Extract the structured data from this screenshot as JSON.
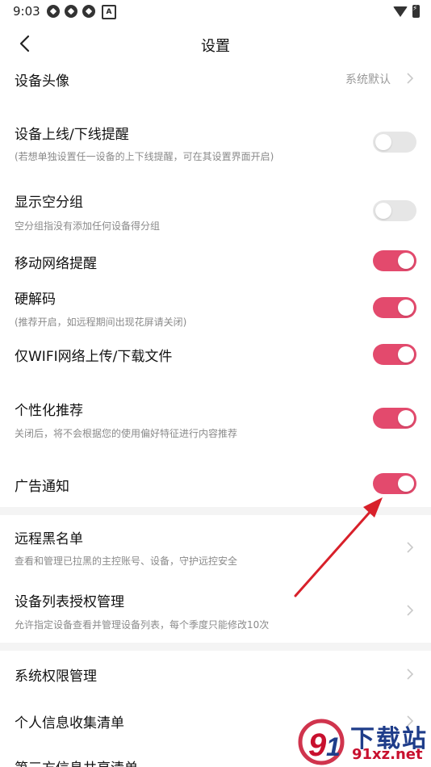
{
  "status_bar": {
    "time": "9:03",
    "left_icons": [
      "app-icon-1",
      "app-icon-2",
      "app-icon-3",
      "a-icon"
    ],
    "right_icons": [
      "wifi-icon",
      "battery-icon"
    ]
  },
  "header": {
    "title": "设置"
  },
  "rows": [
    {
      "label": "设备头像",
      "value": "系统默认"
    },
    {
      "label": "设备上线/下线提醒",
      "sub": "(若想单独设置任一设备的上下线提醒，可在其设置界面开启)",
      "on": false
    },
    {
      "label": "显示空分组",
      "sub": "空分组指没有添加任何设备得分组",
      "on": false
    },
    {
      "label": "移动网络提醒",
      "on": true
    },
    {
      "label": "硬解码",
      "sub": "(推荐开启，如远程期间出现花屏请关闭)",
      "on": true
    },
    {
      "label": "仅WIFI网络上传/下载文件",
      "on": true
    },
    {
      "label": "个性化推荐",
      "sub": "关闭后，将不会根据您的使用偏好特征进行内容推荐",
      "on": true
    },
    {
      "label": "广告通知",
      "on": true
    },
    {
      "label": "远程黑名单",
      "sub": "查看和管理已拉黑的主控账号、设备，守护远控安全"
    },
    {
      "label": "设备列表授权管理",
      "sub": "允许指定设备查看并管理设备列表，每个季度只能修改10次"
    },
    {
      "label": "系统权限管理"
    },
    {
      "label": "个人信息收集清单"
    },
    {
      "label": "第三方信息共享清单"
    }
  ],
  "colors": {
    "accent": "#e34a6d",
    "toggle_off": "#e6e6e6",
    "divider": "#f4f4f4",
    "arrow": "#d8202a"
  },
  "watermark": {
    "main": "下载站",
    "domain": "91xz.net"
  }
}
